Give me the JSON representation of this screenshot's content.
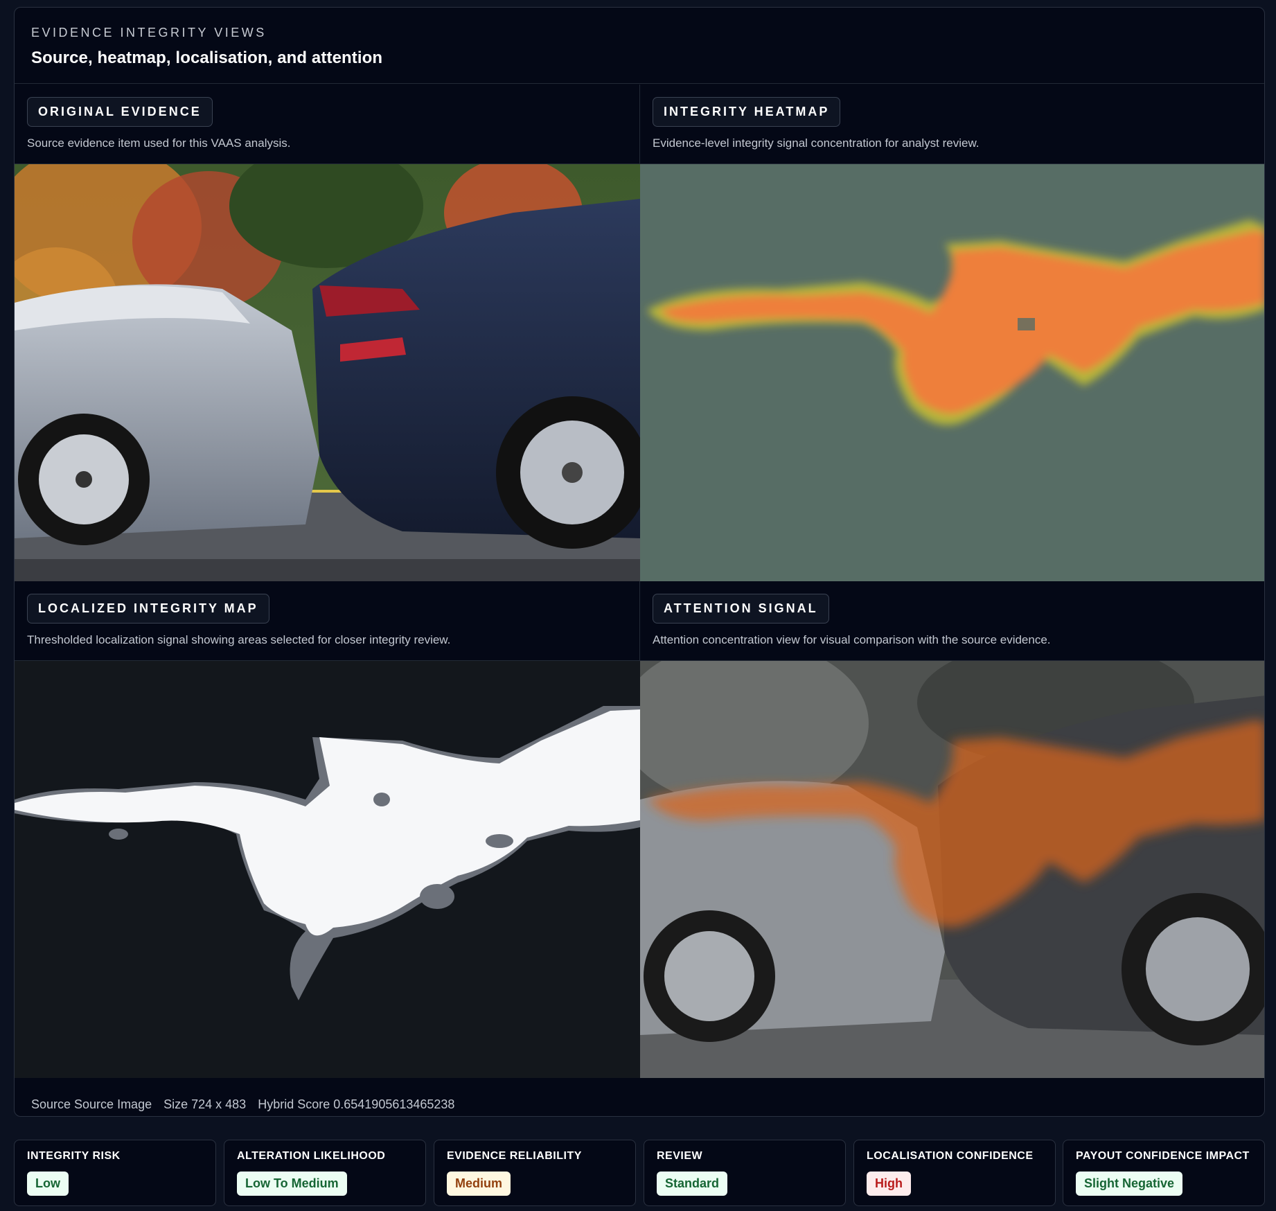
{
  "panel": {
    "eyebrow": "EVIDENCE INTEGRITY VIEWS",
    "title": "Source, heatmap, localisation, and attention"
  },
  "views": [
    {
      "label": "ORIGINAL EVIDENCE",
      "description": "Source evidence item used for this VAAS analysis."
    },
    {
      "label": "INTEGRITY HEATMAP",
      "description": "Evidence-level integrity signal concentration for analyst review."
    },
    {
      "label": "LOCALIZED INTEGRITY MAP",
      "description": "Thresholded localization signal showing areas selected for closer integrity review."
    },
    {
      "label": "ATTENTION SIGNAL",
      "description": "Attention concentration view for visual comparison with the source evidence."
    }
  ],
  "footer": {
    "source": "Source Source Image",
    "size": "Size 724 x 483",
    "score": "Hybrid Score 0.6541905613465238"
  },
  "metrics": [
    {
      "label": "INTEGRITY RISK",
      "value": "Low",
      "bg": "#ecfdf3",
      "fg": "#166534"
    },
    {
      "label": "ALTERATION LIKELIHOOD",
      "value": "Low To Medium",
      "bg": "#ecfdf3",
      "fg": "#166534"
    },
    {
      "label": "EVIDENCE RELIABILITY",
      "value": "Medium",
      "bg": "#fff7e0",
      "fg": "#92400e"
    },
    {
      "label": "REVIEW",
      "value": "Standard",
      "bg": "#ecfdf3",
      "fg": "#166534"
    },
    {
      "label": "LOCALISATION CONFIDENCE",
      "value": "High",
      "bg": "#fdecec",
      "fg": "#b91c1c"
    },
    {
      "label": "PAYOUT CONFIDENCE IMPACT",
      "value": "Slight Negative",
      "bg": "#ecfdf3",
      "fg": "#166534"
    }
  ]
}
